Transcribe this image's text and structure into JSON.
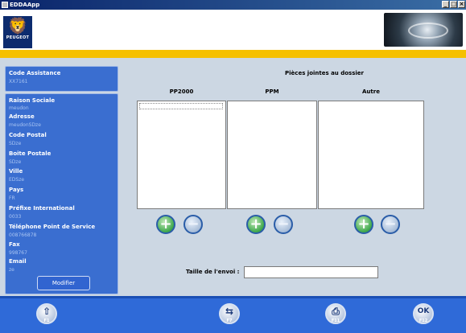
{
  "window": {
    "title": "EDDAApp",
    "controls": [
      "_",
      "□",
      "×"
    ]
  },
  "header": {
    "brand": "PEUGEOT",
    "logo_icon": "lion-emblem"
  },
  "sidebar": {
    "code_assistance_label": "Code Assistance",
    "code_assistance_value": "XX7161",
    "fields": [
      {
        "label": "Raison Sociale",
        "value": "meudon"
      },
      {
        "label": "Adresse",
        "value": "meudonSDze"
      },
      {
        "label": "Code Postal",
        "value": "SDze"
      },
      {
        "label": "Boite Postale",
        "value": "SDze"
      },
      {
        "label": "Ville",
        "value": "EDSze"
      },
      {
        "label": "Pays",
        "value": "FR"
      },
      {
        "label": "Préfixe International",
        "value": "0033"
      },
      {
        "label": "Téléphone Point de Service",
        "value": "008766878"
      },
      {
        "label": "Fax",
        "value": "998767"
      },
      {
        "label": "Email",
        "value": "ze"
      }
    ],
    "modifier_label": "Modifier"
  },
  "main": {
    "title": "Pièces jointes au dossier",
    "columns": [
      {
        "label": "PP2000"
      },
      {
        "label": "PPM"
      },
      {
        "label": "Autre"
      }
    ],
    "add_symbol": "+",
    "remove_symbol": "−",
    "taille_label": "Taille de l'envoi :",
    "taille_value": ""
  },
  "footer": {
    "buttons": [
      {
        "icon": "up-arrow-icon",
        "glyph": "⇧",
        "key": "F1"
      },
      {
        "icon": "transfer-icon",
        "glyph": "⇆",
        "key": "F7"
      },
      {
        "icon": "print-icon",
        "glyph": "⎙",
        "key": "F11"
      },
      {
        "icon": "ok-icon",
        "glyph": "OK",
        "key": "F12"
      }
    ]
  },
  "colors": {
    "accent": "#3a6ed0",
    "brand_yellow": "#f5c000",
    "footer": "#2f6ad8",
    "panel": "#ccd7e3"
  }
}
